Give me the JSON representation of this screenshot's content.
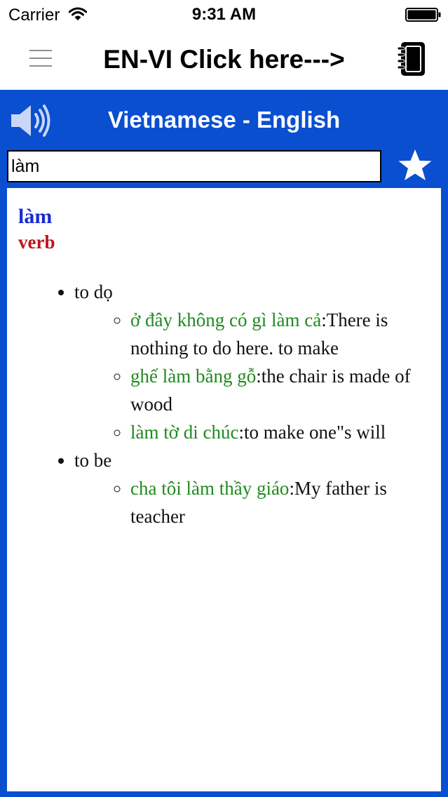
{
  "status_bar": {
    "carrier": "Carrier",
    "time": "9:31 AM",
    "icons": [
      "wifi-icon",
      "battery-icon"
    ]
  },
  "nav": {
    "title": "EN-VI Click here--->",
    "icons": [
      "menu-icon",
      "notebook-icon"
    ]
  },
  "panel": {
    "title": "Vietnamese - English",
    "search_value": "làm",
    "icons": [
      "speaker-icon",
      "star-icon"
    ],
    "colors": {
      "background": "#0a4fd0"
    }
  },
  "entry": {
    "headword": "làm",
    "part_of_speech": "verb",
    "senses": [
      {
        "meaning": "to dọ",
        "examples": [
          {
            "vi": "ở đây không có gì làm cả",
            "en": ":There is nothing to do here. to make"
          },
          {
            "vi": "ghế làm bằng gỗ",
            "en": ":the chair is made of wood"
          },
          {
            "vi": "làm tờ di chúc",
            "en": ":to make one\"s will"
          }
        ]
      },
      {
        "meaning": "to be",
        "examples": [
          {
            "vi": "cha tôi làm thầy giáo",
            "en": ":My father is teacher"
          }
        ]
      }
    ],
    "colors": {
      "headword": "#1a2bd0",
      "pos": "#c0141c",
      "example_vi": "#1f8a1f"
    }
  }
}
